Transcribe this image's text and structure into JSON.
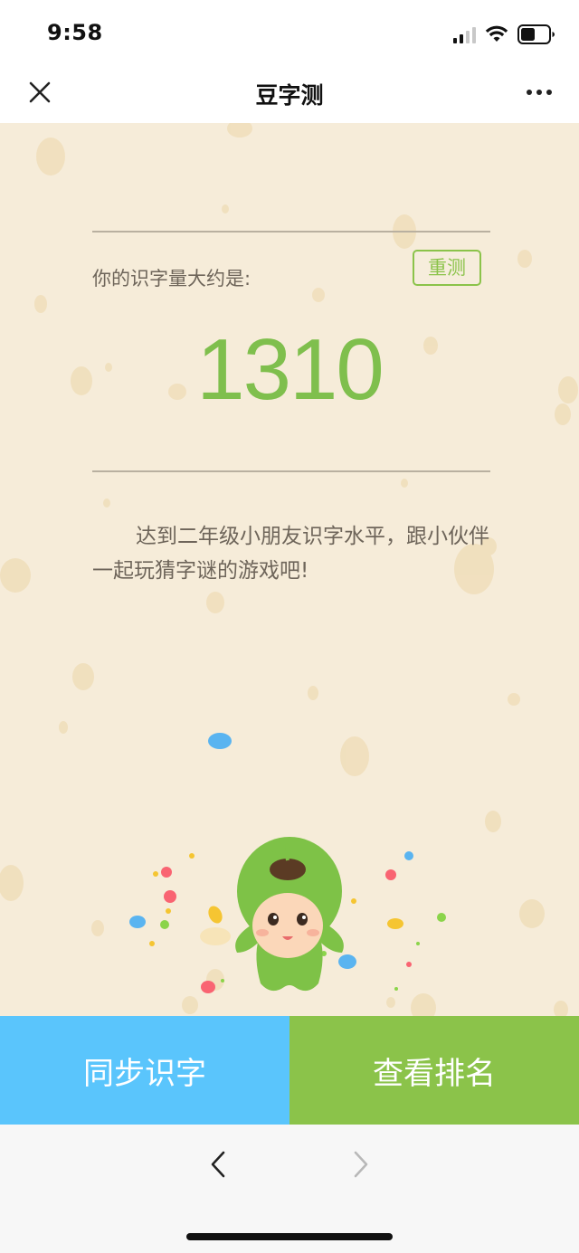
{
  "status_bar": {
    "time": "9:58",
    "icons": [
      "cellular-signal-icon",
      "wifi-icon",
      "battery-icon"
    ]
  },
  "nav": {
    "title": "豆字测",
    "close_icon": "close-icon",
    "more_icon": "more-icon"
  },
  "result": {
    "label": "你的识字量大约是:",
    "retest_label": "重测",
    "score": "1310",
    "message": "达到二年级小朋友识字水平，跟小伙伴一起玩猜字谜的游戏吧!"
  },
  "actions": {
    "sync_label": "同步识字",
    "rank_label": "查看排名"
  },
  "browser": {
    "back_icon": "chevron-left-icon",
    "forward_icon": "chevron-right-icon"
  },
  "colors": {
    "background": "#f6ecd9",
    "accent_green": "#8bc34a",
    "score_green": "#7fbf4d",
    "sync_blue": "#5ac5fc",
    "text_brown": "#6e655a"
  }
}
